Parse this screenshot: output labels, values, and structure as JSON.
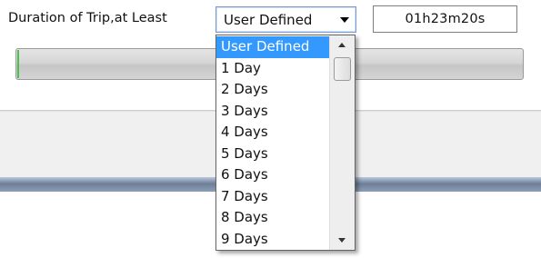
{
  "filter": {
    "label": "Duration of Trip,at Least",
    "selected_value": "User Defined",
    "time_value": "01h23m20s"
  },
  "progress": {
    "fraction": 0.004,
    "fill_color": "#4cc04c"
  },
  "dropdown": {
    "options": [
      "User Defined",
      "1 Day",
      "2 Days",
      "3 Days",
      "4 Days",
      "5 Days",
      "6 Days",
      "7 Days",
      "8 Days",
      "9 Days"
    ],
    "selected_index": 0,
    "highlight_color": "#3399ff"
  },
  "icons": {
    "combo_arrow": "chevron-down-icon",
    "scroll_up": "scroll-up-arrow-icon",
    "scroll_down": "scroll-down-arrow-icon"
  }
}
